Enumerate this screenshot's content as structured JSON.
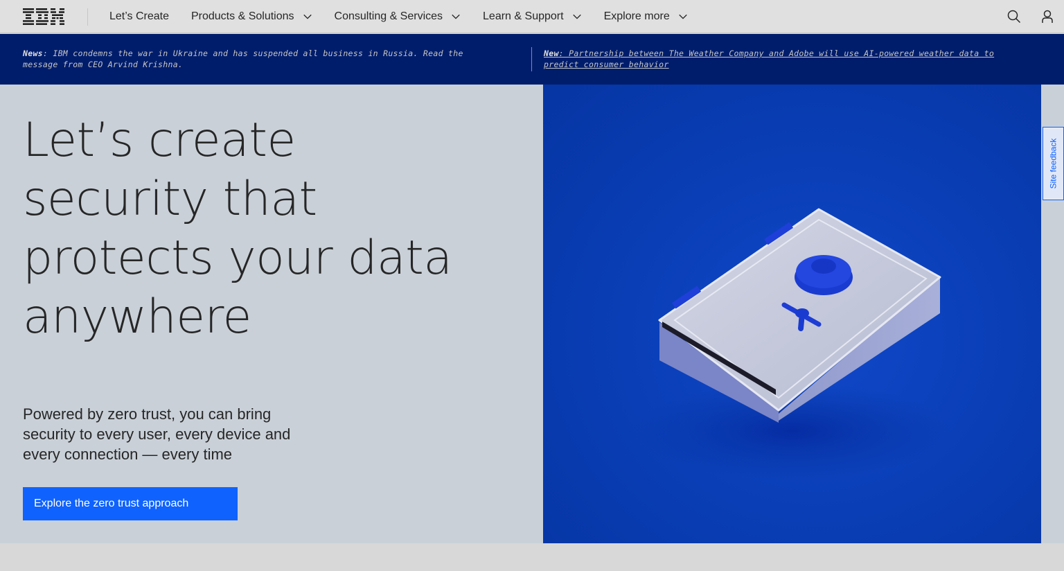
{
  "header": {
    "logo_text": "IBM",
    "nav": [
      {
        "label": "Let’s Create",
        "has_menu": false
      },
      {
        "label": "Products & Solutions",
        "has_menu": true
      },
      {
        "label": "Consulting & Services",
        "has_menu": true
      },
      {
        "label": "Learn & Support",
        "has_menu": true
      },
      {
        "label": "Explore more",
        "has_menu": true
      }
    ],
    "icons": [
      "search-icon",
      "user-icon"
    ]
  },
  "news": {
    "left_prefix": "News",
    "left_text": ": IBM condemns the war in Ukraine and has suspended all business in Russia. Read the message from CEO Arvind Krishna.",
    "right_prefix": "New",
    "right_text": ": Partnership between The Weather Company and Adobe will use AI-powered weather data to predict consumer behavior"
  },
  "hero": {
    "title": "Let’s create security that protects your data anywhere",
    "subtitle": "Powered by zero trust, you can bring security to every user, every device and every connection — every time",
    "cta_label": "Explore the zero trust approach"
  },
  "feedback": {
    "label": "Site feedback"
  },
  "colors": {
    "nav_bg": "#e0e0e0",
    "news_bg": "#001d6c",
    "hero_bg": "#c9d0d8",
    "accent": "#0f62fe",
    "image_blue": "#0a3fb8"
  }
}
